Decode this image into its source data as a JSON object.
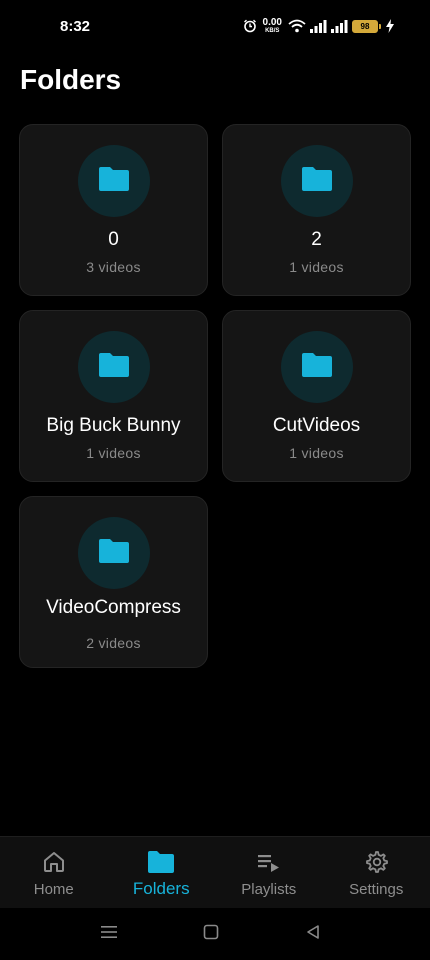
{
  "status_bar": {
    "time": "8:32",
    "net_speed_value": "0.00",
    "net_speed_unit": "KB/S",
    "battery": "98"
  },
  "page": {
    "title": "Folders"
  },
  "folders": [
    {
      "name": "0",
      "count": "3 videos"
    },
    {
      "name": "2",
      "count": "1 videos"
    },
    {
      "name": "Big Buck Bunny",
      "count": "1 videos"
    },
    {
      "name": "CutVideos",
      "count": "1 videos"
    },
    {
      "name": "VideoCompress",
      "count": "2 videos"
    }
  ],
  "nav": {
    "items": [
      {
        "label": "Home",
        "icon": "home-icon"
      },
      {
        "label": "Folders",
        "icon": "folder-icon",
        "active": true
      },
      {
        "label": "Playlists",
        "icon": "playlist-icon"
      },
      {
        "label": "Settings",
        "icon": "gear-icon"
      }
    ]
  },
  "colors": {
    "accent": "#17b3da",
    "background": "#000000",
    "card": "#151515",
    "muted_text": "#8a8a8a"
  }
}
